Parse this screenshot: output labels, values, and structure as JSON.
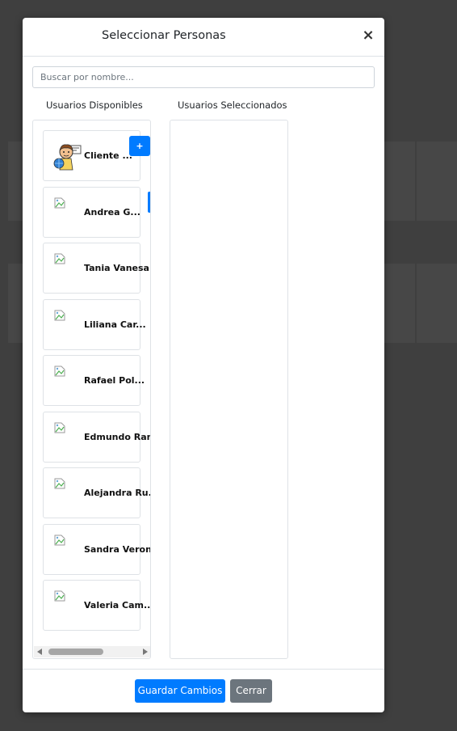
{
  "modal": {
    "title": "Seleccionar Personas",
    "close_symbol": "×"
  },
  "search": {
    "placeholder": "Buscar por nombre..."
  },
  "columns": {
    "available_heading": "Usuarios Disponibles",
    "selected_heading": "Usuarios Seleccionados"
  },
  "users": [
    {
      "name": "Cliente ...",
      "avatar": "cartoon-avatar"
    },
    {
      "name": "Andrea G...",
      "avatar": "broken-image-icon"
    },
    {
      "name": "Tania Vanesa R",
      "avatar": "broken-image-icon"
    },
    {
      "name": "Liliana Car...",
      "avatar": "broken-image-icon"
    },
    {
      "name": "Rafael Pol...",
      "avatar": "broken-image-icon"
    },
    {
      "name": "Edmundo Ram",
      "avatar": "broken-image-icon"
    },
    {
      "name": "Alejandra Ru...",
      "avatar": "broken-image-icon"
    },
    {
      "name": "Sandra Veronic",
      "avatar": "broken-image-icon"
    },
    {
      "name": "Valeria Cam...",
      "avatar": "broken-image-icon"
    }
  ],
  "add_label": "+",
  "footer": {
    "save_label": "Guardar Cambios",
    "close_label": "Cerrar"
  },
  "colors": {
    "primary": "#007bff",
    "secondary": "#6c757d",
    "backdrop": "#3f3f3f"
  }
}
